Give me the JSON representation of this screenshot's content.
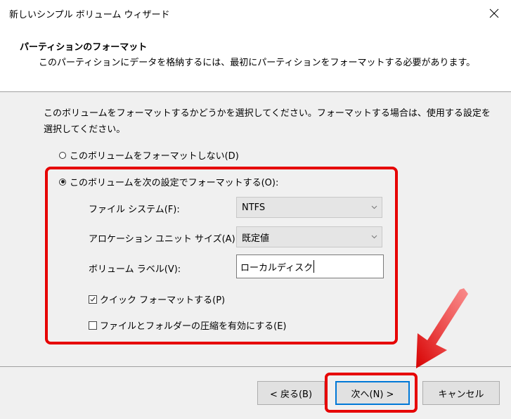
{
  "window": {
    "title": "新しいシンプル ボリューム ウィザード",
    "close_icon": "close-icon"
  },
  "header": {
    "title": "パーティションのフォーマット",
    "subtitle": "このパーティションにデータを格納するには、最初にパーティションをフォーマットする必要があります。"
  },
  "main": {
    "instruction": "このボリュームをフォーマットするかどうかを選択してください。フォーマットする場合は、使用する設定を選択してください。",
    "options": {
      "no_format": {
        "label": "このボリュームをフォーマットしない(D)",
        "selected": false
      },
      "format": {
        "label": "このボリュームを次の設定でフォーマットする(O):",
        "selected": true
      }
    },
    "file_system": {
      "label": "ファイル システム(F):",
      "value": "NTFS"
    },
    "allocation_unit": {
      "label": "アロケーション ユニット サイズ(A):",
      "value": "既定値"
    },
    "volume_label": {
      "label": "ボリューム ラベル(V):",
      "value": "ローカルディスク"
    },
    "quick_format": {
      "label": "クイック フォーマットする(P)",
      "checked": true
    },
    "compression": {
      "label": "ファイルとフォルダーの圧縮を有効にする(E)",
      "checked": false
    }
  },
  "footer": {
    "back_label": "< 戻る(B)",
    "next_label": "次へ(N) >",
    "cancel_label": "キャンセル"
  },
  "colors": {
    "highlight": "#e60000",
    "accent": "#0078d7"
  }
}
